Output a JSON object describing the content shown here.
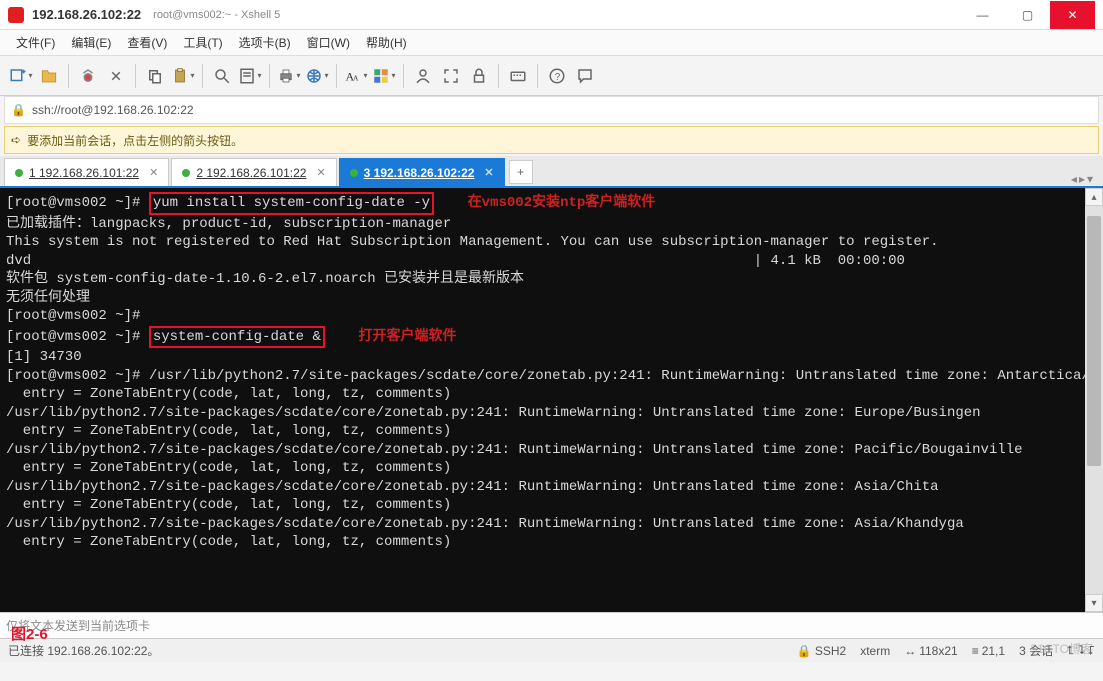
{
  "title": {
    "main": "192.168.26.102:22",
    "sub": "root@vms002:~ - Xshell 5"
  },
  "menu": {
    "file": "文件(F)",
    "edit": "编辑(E)",
    "view": "查看(V)",
    "tools": "工具(T)",
    "tabs": "选项卡(B)",
    "window": "窗口(W)",
    "help": "帮助(H)"
  },
  "address": {
    "url": "ssh://root@192.168.26.102:22"
  },
  "hint": {
    "text": "要添加当前会话，点击左侧的箭头按钮。"
  },
  "tabs": {
    "t1": "1 192.168.26.101:22",
    "t2": "2 192.168.26.101:22",
    "t3": "3 192.168.26.102:22"
  },
  "annotations": {
    "a1": "在vms002安装ntp客户端软件",
    "a2": "打开客户端软件",
    "fig": "图2-6"
  },
  "terminal": {
    "p1a": "[root@vms002 ~]# ",
    "cmd1": "yum install system-config-date -y",
    "l2": "已加载插件：langpacks, product-id, subscription-manager",
    "l3": "This system is not registered to Red Hat Subscription Management. You can use subscription-manager to register.",
    "l4": "dvd                                                                                      | 4.1 kB  00:00:00",
    "l5": "软件包 system-config-date-1.10.6-2.el7.noarch 已安装并且是最新版本",
    "l6": "无须任何处理",
    "l7": "[root@vms002 ~]#",
    "p2a": "[root@vms002 ~]# ",
    "cmd2": "system-config-date &",
    "l9": "[1] 34730",
    "l10": "[root@vms002 ~]# /usr/lib/python2.7/site-packages/scdate/core/zonetab.py:241: RuntimeWarning: Untranslated time zone: Antarctica/Troll",
    "l11": "  entry = ZoneTabEntry(code, lat, long, tz, comments)",
    "l12": "/usr/lib/python2.7/site-packages/scdate/core/zonetab.py:241: RuntimeWarning: Untranslated time zone: Europe/Busingen",
    "l13": "  entry = ZoneTabEntry(code, lat, long, tz, comments)",
    "l14": "/usr/lib/python2.7/site-packages/scdate/core/zonetab.py:241: RuntimeWarning: Untranslated time zone: Pacific/Bougainville",
    "l15": "  entry = ZoneTabEntry(code, lat, long, tz, comments)",
    "l16": "/usr/lib/python2.7/site-packages/scdate/core/zonetab.py:241: RuntimeWarning: Untranslated time zone: Asia/Chita",
    "l17": "  entry = ZoneTabEntry(code, lat, long, tz, comments)",
    "l18": "/usr/lib/python2.7/site-packages/scdate/core/zonetab.py:241: RuntimeWarning: Untranslated time zone: Asia/Khandyga",
    "l19": "  entry = ZoneTabEntry(code, lat, long, tz, comments)"
  },
  "input": {
    "placeholder": "仅将文本发送到当前选项卡"
  },
  "status": {
    "left": "已连接 192.168.26.102:22。",
    "ssh": "SSH2",
    "term": "xterm",
    "size": "118x21",
    "cursor": "21,1",
    "sessions": "3 会话"
  },
  "watermark": "51CTO博客"
}
